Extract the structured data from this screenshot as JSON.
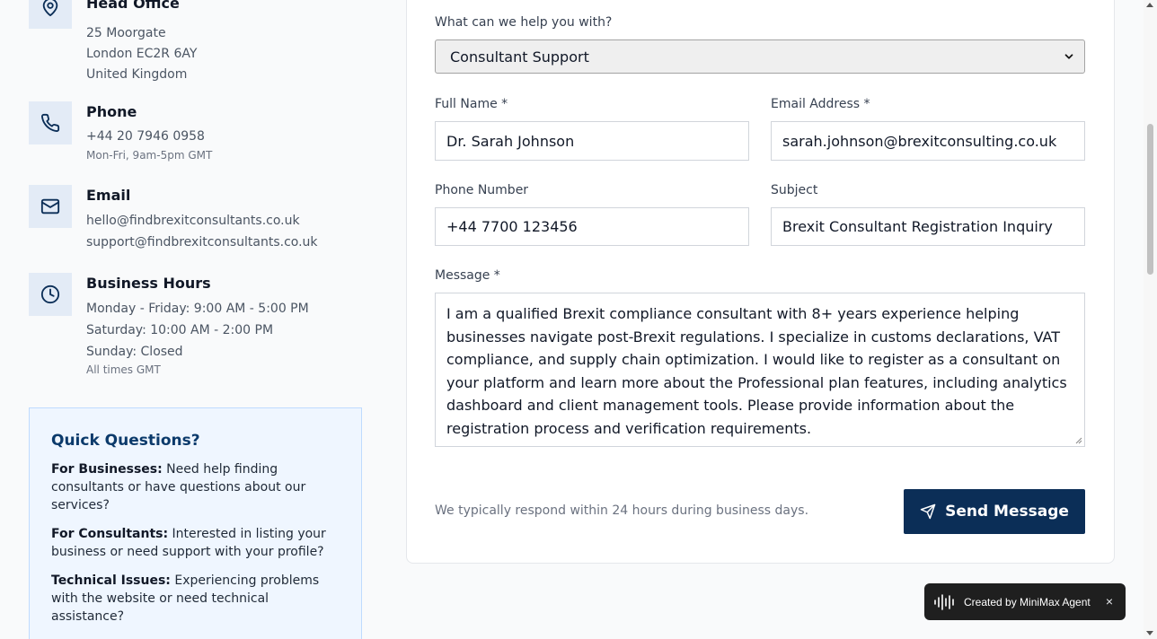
{
  "contact_info": {
    "head_office": {
      "title": "Head Office",
      "line1": "25 Moorgate",
      "line2": "London EC2R 6AY",
      "line3": "United Kingdom",
      "icon": "map-pin-icon"
    },
    "phone": {
      "title": "Phone",
      "number": "+44 20 7946 0958",
      "hours": "Mon-Fri, 9am-5pm GMT",
      "icon": "phone-icon"
    },
    "email": {
      "title": "Email",
      "address1": "hello@findbrexitconsultants.co.uk",
      "address2": "support@findbrexitconsultants.co.uk",
      "icon": "mail-icon"
    },
    "business_hours": {
      "title": "Business Hours",
      "weekdays": "Monday - Friday: 9:00 AM - 5:00 PM",
      "saturday": "Saturday: 10:00 AM - 2:00 PM",
      "sunday": "Sunday: Closed",
      "note": "All times GMT",
      "icon": "clock-icon"
    }
  },
  "quick_questions": {
    "title": "Quick Questions?",
    "businesses_label": "For Businesses:",
    "businesses_text": "Need help finding consultants or have questions about our services?",
    "consultants_label": "For Consultants:",
    "consultants_text": "Interested in listing your business or need support with your profile?",
    "technical_label": "Technical Issues:",
    "technical_text": "Experiencing problems with the website or need technical assistance?"
  },
  "form": {
    "help_label": "What can we help you with?",
    "help_selected": "Consultant Support",
    "name_label": "Full Name *",
    "name_value": "Dr. Sarah Johnson",
    "email_label": "Email Address *",
    "email_value": "sarah.johnson@brexitconsulting.co.uk",
    "phone_label": "Phone Number",
    "phone_value": "+44 7700 123456",
    "subject_label": "Subject",
    "subject_value": "Brexit Consultant Registration Inquiry",
    "message_label": "Message *",
    "message_value": "I am a qualified Brexit compliance consultant with 8+ years experience helping businesses navigate post-Brexit regulations. I specialize in customs declarations, VAT compliance, and supply chain optimization. I would like to register as a consultant on your platform and learn more about the Professional plan features, including analytics dashboard and client management tools. Please provide information about the registration process and verification requirements.",
    "response_note": "We typically respond within 24 hours during business days.",
    "send_label": "Send Message"
  },
  "badge": {
    "text": "Created by MiniMax Agent",
    "close": "×"
  },
  "colors": {
    "brand_navy": "#0b2e57",
    "icon_bg": "#e3ebf6",
    "quick_bg": "#eff6ff"
  }
}
